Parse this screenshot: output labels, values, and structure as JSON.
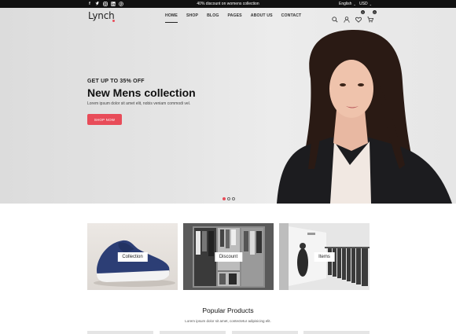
{
  "topbar": {
    "socials": [
      "f",
      "t",
      "ig",
      "in",
      "p"
    ],
    "promo": "40% discount on womens collection",
    "language": "English",
    "currency": "USD"
  },
  "header": {
    "logo": "Lynch",
    "nav": [
      "HOME",
      "SHOP",
      "BLOG",
      "PAGES",
      "ABOUT US",
      "CONTACT"
    ],
    "wishlist_count": "0",
    "cart_count": "0"
  },
  "hero": {
    "kicker": "GET UP TO 35% OFF",
    "title": "New Mens collection",
    "subtitle": "Lorem ipsum dolor sit amet elit, nobis veniam commodi vel.",
    "button": "SHOP NOW"
  },
  "categories": [
    "Collection",
    "Discount",
    "Items"
  ],
  "popular": {
    "title": "Popular Products",
    "subtitle": "Lorem ipsum dolor sit amet, contectetur adipisicing elit."
  },
  "colors": {
    "accent": "#e84c59",
    "dark": "#111111"
  }
}
